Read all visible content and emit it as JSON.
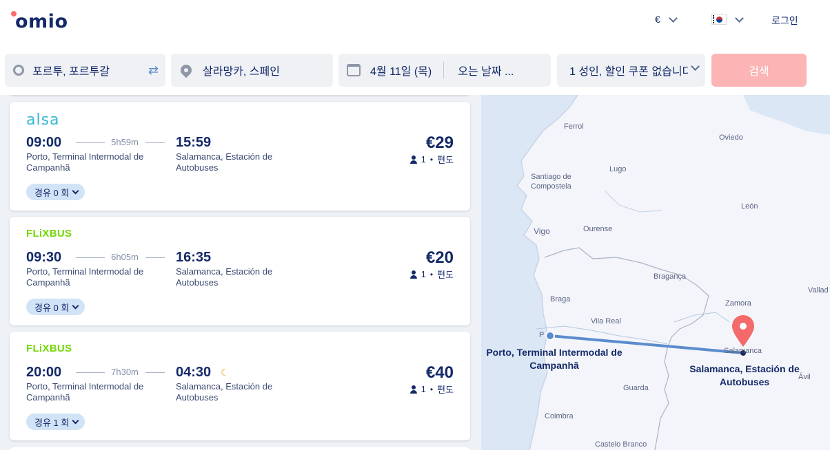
{
  "header": {
    "logo": "omio",
    "currency": "€",
    "login": "로그인"
  },
  "search": {
    "origin": "포르투, 포르투갈",
    "destination": "살라망카, 스페인",
    "depart_date": "4월 11일 (목)",
    "return_date": "오는 날짜 ...",
    "passengers": "1 성인, 할인 쿠폰 없습니다",
    "search_button": "검색"
  },
  "results": [
    {
      "operator": "alsa",
      "dep_time": "09:00",
      "duration": "5h59m",
      "arr_time": "15:59",
      "dep_station": "Porto, Terminal Intermodal de Campanhã",
      "arr_station": "Salamanca, Estación de Autobuses",
      "price": "€29",
      "pax": "1",
      "trip_type": "편도",
      "stops": "경유 0 회",
      "overnight": false
    },
    {
      "operator": "FLiXBUS",
      "dep_time": "09:30",
      "duration": "6h05m",
      "arr_time": "16:35",
      "dep_station": "Porto, Terminal Intermodal de Campanhã",
      "arr_station": "Salamanca, Estación de Autobuses",
      "price": "€20",
      "pax": "1",
      "trip_type": "편도",
      "stops": "경유 0 회",
      "overnight": false
    },
    {
      "operator": "FLiXBUS",
      "dep_time": "20:00",
      "duration": "7h30m",
      "arr_time": "04:30",
      "dep_station": "Porto, Terminal Intermodal de Campanhã",
      "arr_station": "Salamanca, Estación de Autobuses",
      "price": "€40",
      "pax": "1",
      "trip_type": "편도",
      "stops": "경유 1 회",
      "overnight": true
    }
  ],
  "map": {
    "cities": [
      "Ferrol",
      "Oviedo",
      "Santiago de Compostela",
      "Lugo",
      "León",
      "Vigo",
      "Ourense",
      "Bragança",
      "Vallad",
      "Braga",
      "Zamora",
      "Vila Real",
      "P",
      "Salamanca",
      "Ávil",
      "Guarda",
      "Coimbra",
      "Castelo Branco"
    ],
    "origin_label": "Porto, Terminal Intermodal de Campanhã",
    "destination_label": "Salamanca, Estación de Autobuses",
    "colors": {
      "route": "#5b8ccc",
      "pin": "#f46a6a",
      "sea": "#dbe7f4"
    }
  }
}
